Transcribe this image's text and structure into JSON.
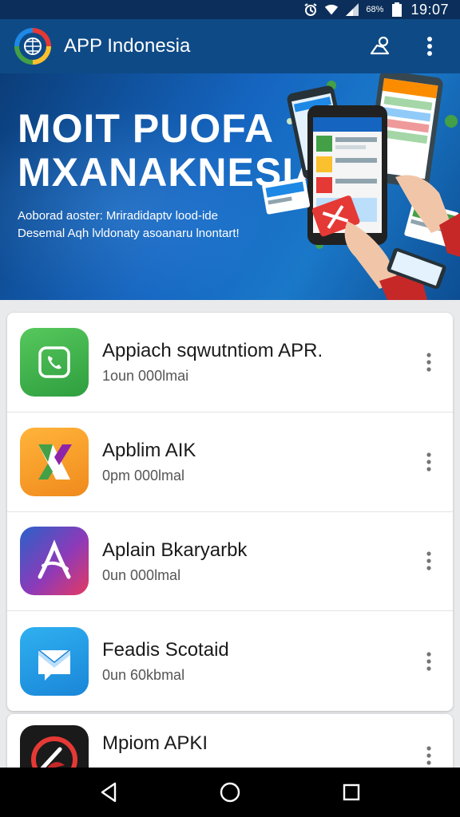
{
  "status_bar": {
    "battery_text": "68%",
    "time": "19:07",
    "icons": [
      "alarm-icon",
      "wifi-icon",
      "signal-icon",
      "battery-icon"
    ]
  },
  "app_bar": {
    "title": "APP Indonesia",
    "actions": [
      "profile-icon",
      "overflow-menu-icon"
    ]
  },
  "banner": {
    "headline_line1": "MOIT PUOFA",
    "headline_line2": "MXANAKNESIA",
    "sub_line1": "Aoborad aoster: Mriradidaptv lood-ide",
    "sub_line2": "Desemal Aqh lvldonaty asoanaru lnontart!"
  },
  "apps": [
    {
      "name": "Appiach sqwutntiom APR.",
      "meta": "1oun 000lmai",
      "icon": "phone-app-icon",
      "color": "#3bb54a"
    },
    {
      "name": "Apblim AIK",
      "meta": "0pm 000lmal",
      "icon": "x-app-icon",
      "color": "#f6a623"
    },
    {
      "name": "Aplain Bkaryarbk",
      "meta": "0un 000lmal",
      "icon": "a-app-icon",
      "color": "#7b3ab8"
    },
    {
      "name": "Feadis Scotaid",
      "meta": "0un 60kbmal",
      "icon": "mail-app-icon",
      "color": "#1e9be9"
    },
    {
      "name": "Mpiom APKI",
      "meta": "",
      "icon": "speed-app-icon",
      "color": "#1a1a1a"
    }
  ],
  "nav_bar": {
    "buttons": [
      "back-icon",
      "home-icon",
      "recents-icon"
    ]
  }
}
